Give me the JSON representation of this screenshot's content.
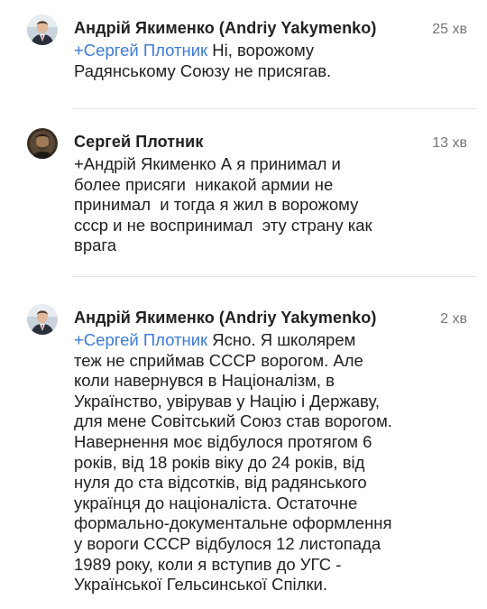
{
  "comments": [
    {
      "author": "Андрій Якименко (Andriy Yakymenko)",
      "time": "25 хв",
      "mention": "+Сергей Плотник",
      "lines": [
        " Ні, ворожому",
        "Радянському Союзу не присягав."
      ]
    },
    {
      "author": "Сергей Плотник",
      "time": "13 хв",
      "lines": [
        "+Андрій Якименко А я принимал и",
        "более присяги  никакой армии не",
        "принимал  и тогда я жил в ворожому",
        "ссср и не воспринимал  эту страну как",
        "врага"
      ]
    },
    {
      "author": "Андрій Якименко (Andriy Yakymenko)",
      "time": "2 хв",
      "mention": "+Сергей Плотник",
      "lines": [
        " Ясно. Я школярем",
        "теж не сприймав СССР ворогом. Але",
        "коли навернувся в Націоналізм, в",
        "Українство, увірував у Націю і Державу,",
        "для мене Совітський Союз став ворогом.",
        "Навернення моє відбулося протягом 6",
        "років, від 18 років віку до 24 років, від",
        "нуля до ста відсотків, від радянського",
        "українця до націоналіста. Остаточне",
        "формально-документальне оформлення",
        "у вороги СССР відбулося 12 листопада",
        "1989 року, коли я вступив до УГС -",
        "Української Гельсинської Спілки."
      ]
    }
  ],
  "colors": {
    "mention": "#3d7bd6",
    "time": "#757575",
    "text": "#212121"
  },
  "icons": {
    "avatar_yakymenko": "avatar-andriy-yakymenko-icon",
    "avatar_plotnik": "avatar-sergey-plotnik-icon"
  }
}
